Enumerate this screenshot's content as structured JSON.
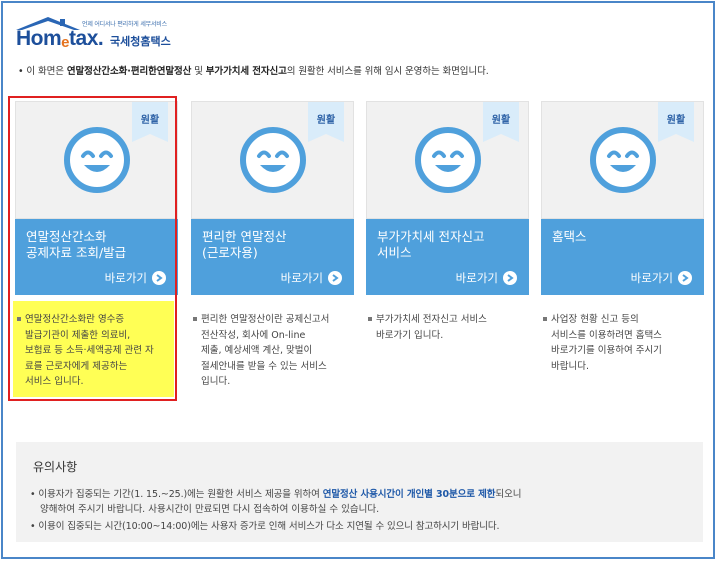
{
  "logo": {
    "tagline": "언제 어디서나 편리하게 세무서비스",
    "brand_home": "Hom",
    "brand_e": "e",
    "brand_tax": "tax.",
    "brand_korean": "국세청홈택스"
  },
  "notice": {
    "prefix": "• 이 화면은 ",
    "bold1": "연말정산간소화·편리한연말정산",
    "mid": " 및 ",
    "bold2": "부가가치세 전자신고",
    "suffix": "의 원활한 서비스를 위해 임시 운영하는 화면입니다."
  },
  "cards": [
    {
      "badge": "원활",
      "title": "연말정산간소화\n공제자료 조회/발급",
      "go_label": "바로가기",
      "desc": "연말정산간소화란 영수증\n발급기관이 제출한 의료비,\n보험료 등 소득·세액공제 관련 자\n료를 근로자에게 제공하는\n서비스 입니다."
    },
    {
      "badge": "원활",
      "title": "편리한 연말정산\n(근로자용)",
      "go_label": "바로가기",
      "desc": "편리한 연말정산이란 공제신고서\n전산작성, 회사에 On-line\n제출, 예상세액 계산, 맞벌이\n절세안내를 받을 수 있는 서비스\n입니다."
    },
    {
      "badge": "원활",
      "title": "부가가치세 전자신고\n서비스",
      "go_label": "바로가기",
      "desc": "부가가치세 전자신고 서비스\n바로가기 입니다."
    },
    {
      "badge": "원활",
      "title": "홈택스",
      "go_label": "바로가기",
      "desc": "사업장 현황 신고 등의\n서비스를 이용하려면 홈택스\n바로가기를 이용하여 주시기\n바랍니다."
    }
  ],
  "caution": {
    "title": "유의사항",
    "line1_a": "• 이용자가 집중되는 기간(1. 15.~25.)에는 원활한 서비스 제공을 위하여 ",
    "line1_b": "연말정산 사용시간이 개인별 30분으로 제한",
    "line1_c": "되오니",
    "line1_cont": "양해하여 주시기 바랍니다. 사용시간이 만료되면 다시 접속하여 이용하실 수 있습니다.",
    "line2": "• 이용이 집중되는 시간(10:00~14:00)에는 사용자 증가로 인해 서비스가 다소 지연될 수 있으니 참고하시기 바랍니다."
  },
  "colors": {
    "card_blue": "#4fa0dc",
    "brand_blue": "#1d4f9b",
    "highlight_red": "#e02020",
    "highlight_yellow": "#ffff55"
  }
}
